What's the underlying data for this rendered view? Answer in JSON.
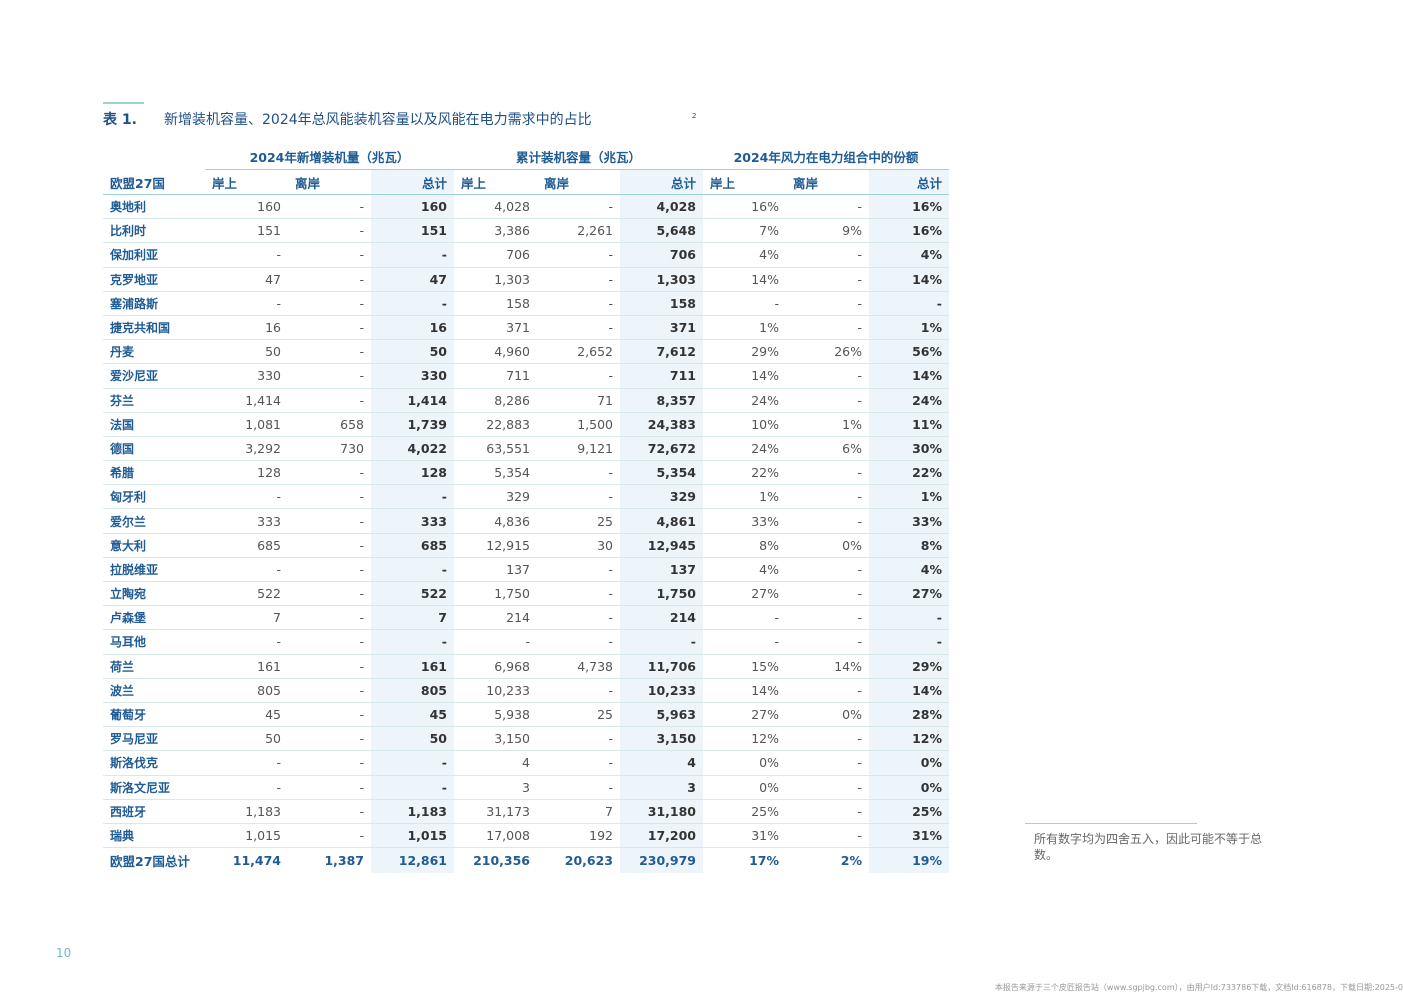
{
  "title": {
    "label": "表 1.",
    "text": "新增装机容量、2024年总风能装机容量以及风能在电力需求中的占比",
    "footnote": "2"
  },
  "group_headers": [
    "2024年新增装机量（兆瓦）",
    "累计装机容量（兆瓦）",
    "2024年风力在电力组合中的份额"
  ],
  "column_headers": [
    "欧盟27国",
    "岸上",
    "离岸",
    "总计",
    "岸上",
    "离岸",
    "总计",
    "岸上",
    "离岸",
    "总计"
  ],
  "rows": [
    [
      "奥地利",
      "160",
      "-",
      "160",
      "4,028",
      "-",
      "4,028",
      "16%",
      "-",
      "16%"
    ],
    [
      "比利时",
      "151",
      "-",
      "151",
      "3,386",
      "2,261",
      "5,648",
      "7%",
      "9%",
      "16%"
    ],
    [
      "保加利亚",
      "-",
      "-",
      "-",
      "706",
      "-",
      "706",
      "4%",
      "-",
      "4%"
    ],
    [
      "克罗地亚",
      "47",
      "-",
      "47",
      "1,303",
      "-",
      "1,303",
      "14%",
      "-",
      "14%"
    ],
    [
      "塞浦路斯",
      "-",
      "-",
      "-",
      "158",
      "-",
      "158",
      "-",
      "-",
      "-"
    ],
    [
      "捷克共和国",
      "16",
      "-",
      "16",
      "371",
      "-",
      "371",
      "1%",
      "-",
      "1%"
    ],
    [
      "丹麦",
      "50",
      "-",
      "50",
      "4,960",
      "2,652",
      "7,612",
      "29%",
      "26%",
      "56%"
    ],
    [
      "爱沙尼亚",
      "330",
      "-",
      "330",
      "711",
      "-",
      "711",
      "14%",
      "-",
      "14%"
    ],
    [
      "芬兰",
      "1,414",
      "-",
      "1,414",
      "8,286",
      "71",
      "8,357",
      "24%",
      "-",
      "24%"
    ],
    [
      "法国",
      "1,081",
      "658",
      "1,739",
      "22,883",
      "1,500",
      "24,383",
      "10%",
      "1%",
      "11%"
    ],
    [
      "德国",
      "3,292",
      "730",
      "4,022",
      "63,551",
      "9,121",
      "72,672",
      "24%",
      "6%",
      "30%"
    ],
    [
      "希腊",
      "128",
      "-",
      "128",
      "5,354",
      "-",
      "5,354",
      "22%",
      "-",
      "22%"
    ],
    [
      "匈牙利",
      "-",
      "-",
      "-",
      "329",
      "-",
      "329",
      "1%",
      "-",
      "1%"
    ],
    [
      "爱尔兰",
      "333",
      "-",
      "333",
      "4,836",
      "25",
      "4,861",
      "33%",
      "-",
      "33%"
    ],
    [
      "意大利",
      "685",
      "-",
      "685",
      "12,915",
      "30",
      "12,945",
      "8%",
      "0%",
      "8%"
    ],
    [
      "拉脱维亚",
      "-",
      "-",
      "-",
      "137",
      "-",
      "137",
      "4%",
      "-",
      "4%"
    ],
    [
      "立陶宛",
      "522",
      "-",
      "522",
      "1,750",
      "-",
      "1,750",
      "27%",
      "-",
      "27%"
    ],
    [
      "卢森堡",
      "7",
      "-",
      "7",
      "214",
      "-",
      "214",
      "-",
      "-",
      "-"
    ],
    [
      "马耳他",
      "-",
      "-",
      "-",
      "-",
      "-",
      "-",
      "-",
      "-",
      "-"
    ],
    [
      "荷兰",
      "161",
      "-",
      "161",
      "6,968",
      "4,738",
      "11,706",
      "15%",
      "14%",
      "29%"
    ],
    [
      "波兰",
      "805",
      "-",
      "805",
      "10,233",
      "-",
      "10,233",
      "14%",
      "-",
      "14%"
    ],
    [
      "葡萄牙",
      "45",
      "-",
      "45",
      "5,938",
      "25",
      "5,963",
      "27%",
      "0%",
      "28%"
    ],
    [
      "罗马尼亚",
      "50",
      "-",
      "50",
      "3,150",
      "-",
      "3,150",
      "12%",
      "-",
      "12%"
    ],
    [
      "斯洛伐克",
      "-",
      "-",
      "-",
      "4",
      "-",
      "4",
      "0%",
      "-",
      "0%"
    ],
    [
      "斯洛文尼亚",
      "-",
      "-",
      "-",
      "3",
      "-",
      "3",
      "0%",
      "-",
      "0%"
    ],
    [
      "西班牙",
      "1,183",
      "-",
      "1,183",
      "31,173",
      "7",
      "31,180",
      "25%",
      "-",
      "25%"
    ],
    [
      "瑞典",
      "1,015",
      "-",
      "1,015",
      "17,008",
      "192",
      "17,200",
      "31%",
      "-",
      "31%"
    ]
  ],
  "total_row": [
    "欧盟27国总计",
    "11,474",
    "1,387",
    "12,861",
    "210,356",
    "20,623",
    "230,979",
    "17%",
    "2%",
    "19%"
  ],
  "note": "所有数字均为四舍五入，因此可能不等于总数。",
  "page_number": "10",
  "source_line": "本报告来源于三个皮匠报告站（www.sgpjbg.com），由用户Id:733786下载，文档Id:616878，下载日期:2025-0",
  "colors": {
    "heading": "#1f5b94",
    "accent": "#9fd3cf",
    "total_fill": "#eef5fa"
  }
}
